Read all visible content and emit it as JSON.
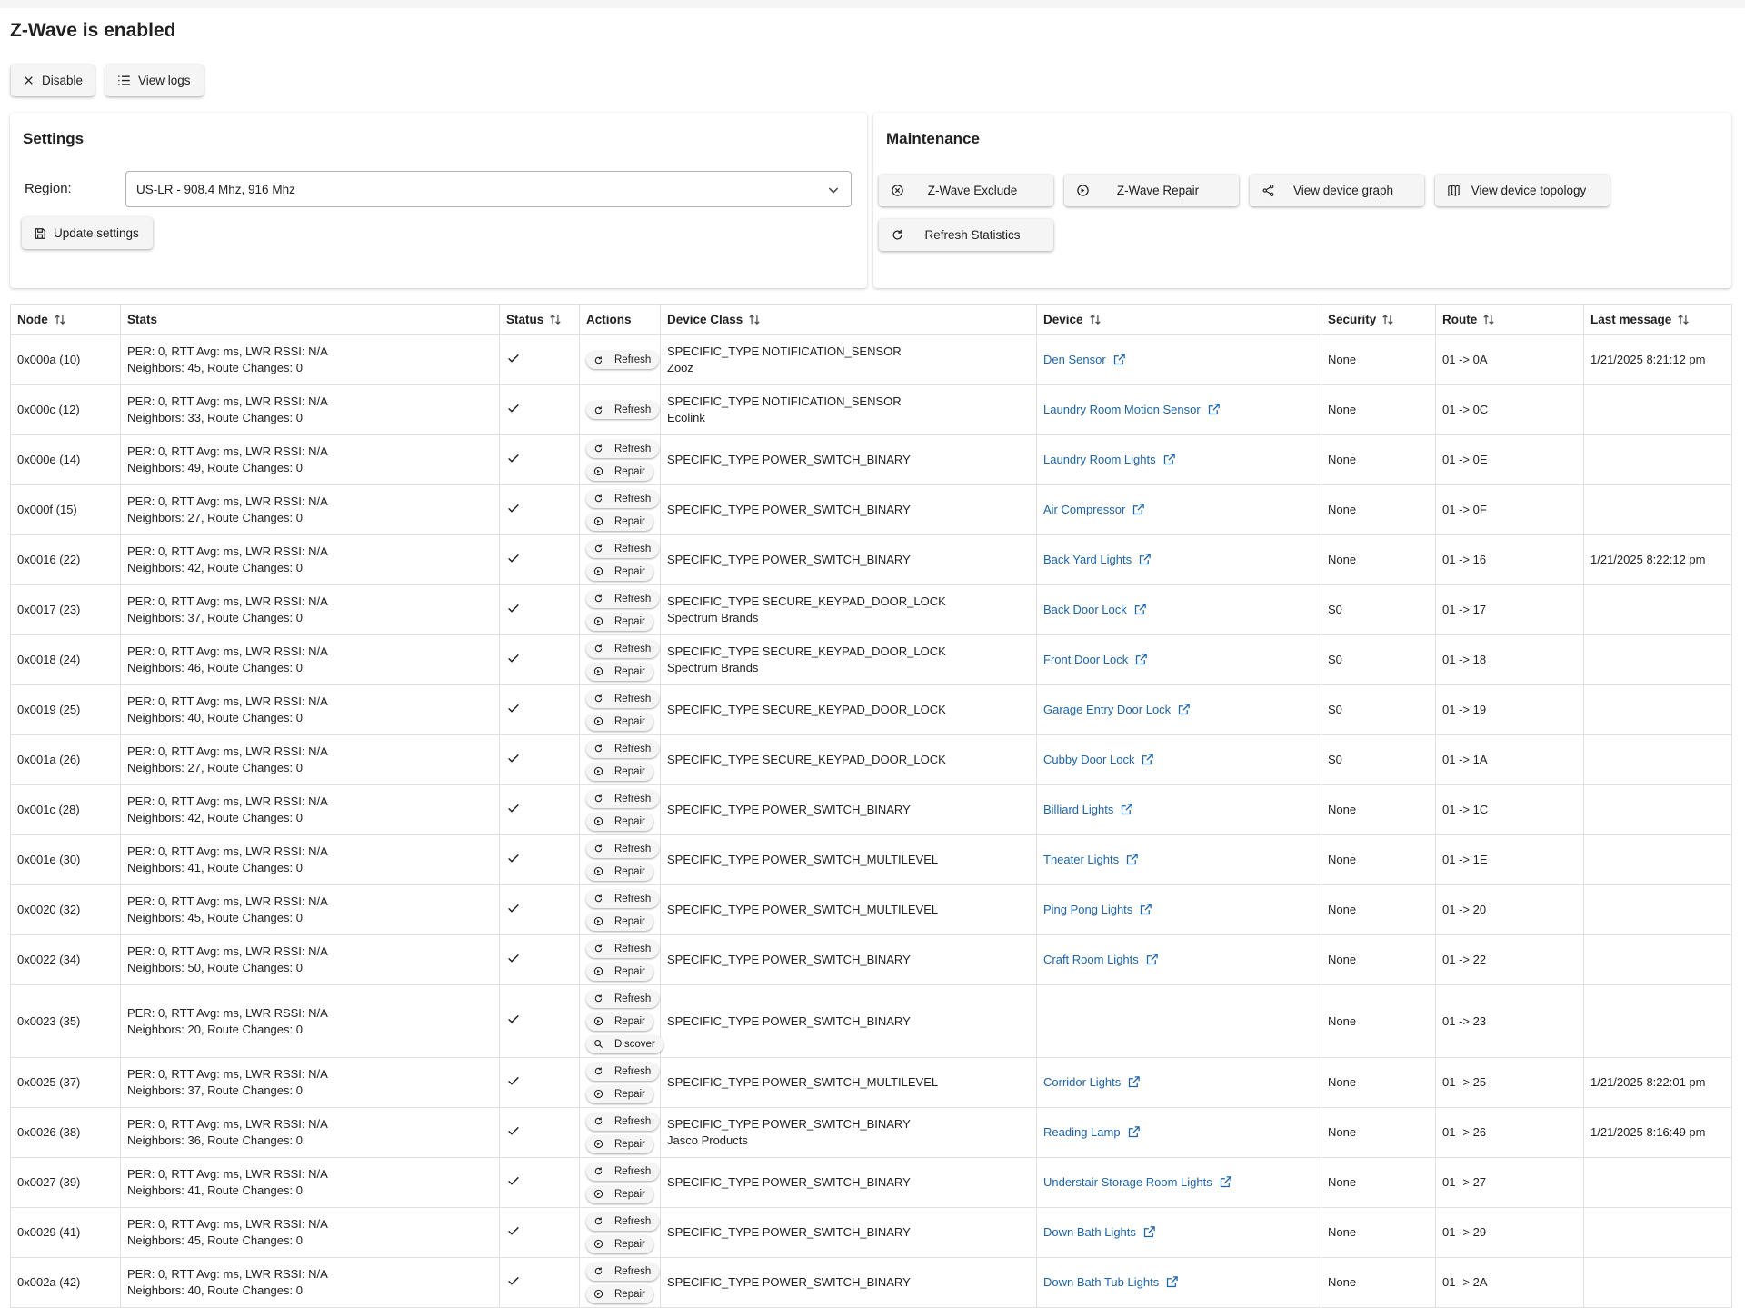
{
  "page": {
    "title": "Z-Wave is enabled",
    "disable_label": "Disable",
    "logs_label": "View logs"
  },
  "settings": {
    "title": "Settings",
    "region_label": "Region:",
    "region_value": "US-LR - 908.4 Mhz, 916 Mhz",
    "update_label": "Update settings"
  },
  "maintenance": {
    "title": "Maintenance",
    "buttons": [
      {
        "label": "Z-Wave Exclude",
        "icon": "cancel-circle-icon"
      },
      {
        "label": "Z-Wave Repair",
        "icon": "repair-icon"
      },
      {
        "label": "View device graph",
        "icon": "share-icon"
      },
      {
        "label": "View device topology",
        "icon": "map-icon"
      },
      {
        "label": "Refresh Statistics",
        "icon": "refresh-icon"
      }
    ]
  },
  "colors": {
    "link": "#1c63a8",
    "button_bg": "#f5f5f5",
    "border": "#e0e0e0"
  },
  "table": {
    "columns": [
      "Node",
      "Stats",
      "Status",
      "Actions",
      "Device Class",
      "Device",
      "Security",
      "Route",
      "Last message"
    ],
    "action_labels": {
      "refresh": "Refresh",
      "repair": "Repair",
      "discover": "Discover"
    },
    "status_icon": "check-icon",
    "rows": [
      {
        "node": "0x000a (10)",
        "stats1": "PER: 0, RTT Avg: ms, LWR RSSI: N/A",
        "stats2": "Neighbors: 45, Route Changes: 0",
        "actions": [
          "refresh"
        ],
        "class": "SPECIFIC_TYPE NOTIFICATION_SENSOR",
        "class2": "Zooz",
        "device": "Den Sensor",
        "security": "None",
        "route": "01 -> 0A",
        "last": "1/21/2025 8:21:12 pm"
      },
      {
        "node": "0x000c (12)",
        "stats1": "PER: 0, RTT Avg: ms, LWR RSSI: N/A",
        "stats2": "Neighbors: 33, Route Changes: 0",
        "actions": [
          "refresh"
        ],
        "class": "SPECIFIC_TYPE NOTIFICATION_SENSOR",
        "class2": "Ecolink",
        "device": "Laundry Room Motion Sensor",
        "security": "None",
        "route": "01 -> 0C",
        "last": ""
      },
      {
        "node": "0x000e (14)",
        "stats1": "PER: 0, RTT Avg: ms, LWR RSSI: N/A",
        "stats2": "Neighbors: 49, Route Changes: 0",
        "actions": [
          "refresh",
          "repair"
        ],
        "class": "SPECIFIC_TYPE POWER_SWITCH_BINARY",
        "class2": "",
        "device": "Laundry Room Lights",
        "security": "None",
        "route": "01 -> 0E",
        "last": ""
      },
      {
        "node": "0x000f (15)",
        "stats1": "PER: 0, RTT Avg: ms, LWR RSSI: N/A",
        "stats2": "Neighbors: 27, Route Changes: 0",
        "actions": [
          "refresh",
          "repair"
        ],
        "class": "SPECIFIC_TYPE POWER_SWITCH_BINARY",
        "class2": "",
        "device": "Air Compressor",
        "security": "None",
        "route": "01 -> 0F",
        "last": ""
      },
      {
        "node": "0x0016 (22)",
        "stats1": "PER: 0, RTT Avg: ms, LWR RSSI: N/A",
        "stats2": "Neighbors: 42, Route Changes: 0",
        "actions": [
          "refresh",
          "repair"
        ],
        "class": "SPECIFIC_TYPE POWER_SWITCH_BINARY",
        "class2": "",
        "device": "Back Yard Lights",
        "security": "None",
        "route": "01 -> 16",
        "last": "1/21/2025 8:22:12 pm"
      },
      {
        "node": "0x0017 (23)",
        "stats1": "PER: 0, RTT Avg: ms, LWR RSSI: N/A",
        "stats2": "Neighbors: 37, Route Changes: 0",
        "actions": [
          "refresh",
          "repair"
        ],
        "class": "SPECIFIC_TYPE SECURE_KEYPAD_DOOR_LOCK",
        "class2": "Spectrum Brands",
        "device": "Back Door Lock",
        "security": "S0",
        "route": "01 -> 17",
        "last": ""
      },
      {
        "node": "0x0018 (24)",
        "stats1": "PER: 0, RTT Avg: ms, LWR RSSI: N/A",
        "stats2": "Neighbors: 46, Route Changes: 0",
        "actions": [
          "refresh",
          "repair"
        ],
        "class": "SPECIFIC_TYPE SECURE_KEYPAD_DOOR_LOCK",
        "class2": "Spectrum Brands",
        "device": "Front Door Lock",
        "security": "S0",
        "route": "01 -> 18",
        "last": ""
      },
      {
        "node": "0x0019 (25)",
        "stats1": "PER: 0, RTT Avg: ms, LWR RSSI: N/A",
        "stats2": "Neighbors: 40, Route Changes: 0",
        "actions": [
          "refresh",
          "repair"
        ],
        "class": "SPECIFIC_TYPE SECURE_KEYPAD_DOOR_LOCK",
        "class2": "",
        "device": "Garage Entry Door Lock",
        "security": "S0",
        "route": "01 -> 19",
        "last": ""
      },
      {
        "node": "0x001a (26)",
        "stats1": "PER: 0, RTT Avg: ms, LWR RSSI: N/A",
        "stats2": "Neighbors: 27, Route Changes: 0",
        "actions": [
          "refresh",
          "repair"
        ],
        "class": "SPECIFIC_TYPE SECURE_KEYPAD_DOOR_LOCK",
        "class2": "",
        "device": "Cubby Door Lock",
        "security": "S0",
        "route": "01 -> 1A",
        "last": ""
      },
      {
        "node": "0x001c (28)",
        "stats1": "PER: 0, RTT Avg: ms, LWR RSSI: N/A",
        "stats2": "Neighbors: 42, Route Changes: 0",
        "actions": [
          "refresh",
          "repair"
        ],
        "class": "SPECIFIC_TYPE POWER_SWITCH_BINARY",
        "class2": "",
        "device": "Billiard Lights",
        "security": "None",
        "route": "01 -> 1C",
        "last": ""
      },
      {
        "node": "0x001e (30)",
        "stats1": "PER: 0, RTT Avg: ms, LWR RSSI: N/A",
        "stats2": "Neighbors: 41, Route Changes: 0",
        "actions": [
          "refresh",
          "repair"
        ],
        "class": "SPECIFIC_TYPE POWER_SWITCH_MULTILEVEL",
        "class2": "",
        "device": "Theater Lights",
        "security": "None",
        "route": "01 -> 1E",
        "last": ""
      },
      {
        "node": "0x0020 (32)",
        "stats1": "PER: 0, RTT Avg: ms, LWR RSSI: N/A",
        "stats2": "Neighbors: 45, Route Changes: 0",
        "actions": [
          "refresh",
          "repair"
        ],
        "class": "SPECIFIC_TYPE POWER_SWITCH_MULTILEVEL",
        "class2": "",
        "device": "Ping Pong Lights",
        "security": "None",
        "route": "01 -> 20",
        "last": ""
      },
      {
        "node": "0x0022 (34)",
        "stats1": "PER: 0, RTT Avg: ms, LWR RSSI: N/A",
        "stats2": "Neighbors: 50, Route Changes: 0",
        "actions": [
          "refresh",
          "repair"
        ],
        "class": "SPECIFIC_TYPE POWER_SWITCH_BINARY",
        "class2": "",
        "device": "Craft Room Lights",
        "security": "None",
        "route": "01 -> 22",
        "last": ""
      },
      {
        "node": "0x0023 (35)",
        "stats1": "PER: 0, RTT Avg: ms, LWR RSSI: N/A",
        "stats2": "Neighbors: 20, Route Changes: 0",
        "actions": [
          "refresh",
          "repair",
          "discover"
        ],
        "class": "SPECIFIC_TYPE POWER_SWITCH_BINARY",
        "class2": "",
        "device": "",
        "security": "None",
        "route": "01 -> 23",
        "last": ""
      },
      {
        "node": "0x0025 (37)",
        "stats1": "PER: 0, RTT Avg: ms, LWR RSSI: N/A",
        "stats2": "Neighbors: 37, Route Changes: 0",
        "actions": [
          "refresh",
          "repair"
        ],
        "class": "SPECIFIC_TYPE POWER_SWITCH_MULTILEVEL",
        "class2": "",
        "device": "Corridor Lights",
        "security": "None",
        "route": "01 -> 25",
        "last": "1/21/2025 8:22:01 pm"
      },
      {
        "node": "0x0026 (38)",
        "stats1": "PER: 0, RTT Avg: ms, LWR RSSI: N/A",
        "stats2": "Neighbors: 36, Route Changes: 0",
        "actions": [
          "refresh",
          "repair"
        ],
        "class": "SPECIFIC_TYPE POWER_SWITCH_BINARY",
        "class2": "Jasco Products",
        "device": "Reading Lamp",
        "security": "None",
        "route": "01 -> 26",
        "last": "1/21/2025 8:16:49 pm"
      },
      {
        "node": "0x0027 (39)",
        "stats1": "PER: 0, RTT Avg: ms, LWR RSSI: N/A",
        "stats2": "Neighbors: 41, Route Changes: 0",
        "actions": [
          "refresh",
          "repair"
        ],
        "class": "SPECIFIC_TYPE POWER_SWITCH_BINARY",
        "class2": "",
        "device": "Understair Storage Room Lights",
        "security": "None",
        "route": "01 -> 27",
        "last": ""
      },
      {
        "node": "0x0029 (41)",
        "stats1": "PER: 0, RTT Avg: ms, LWR RSSI: N/A",
        "stats2": "Neighbors: 45, Route Changes: 0",
        "actions": [
          "refresh",
          "repair"
        ],
        "class": "SPECIFIC_TYPE POWER_SWITCH_BINARY",
        "class2": "",
        "device": "Down Bath Lights",
        "security": "None",
        "route": "01 -> 29",
        "last": ""
      },
      {
        "node": "0x002a (42)",
        "stats1": "PER: 0, RTT Avg: ms, LWR RSSI: N/A",
        "stats2": "Neighbors: 40, Route Changes: 0",
        "actions": [
          "refresh",
          "repair"
        ],
        "class": "SPECIFIC_TYPE POWER_SWITCH_BINARY",
        "class2": "",
        "device": "Down Bath Tub Lights",
        "security": "None",
        "route": "01 -> 2A",
        "last": ""
      }
    ]
  }
}
